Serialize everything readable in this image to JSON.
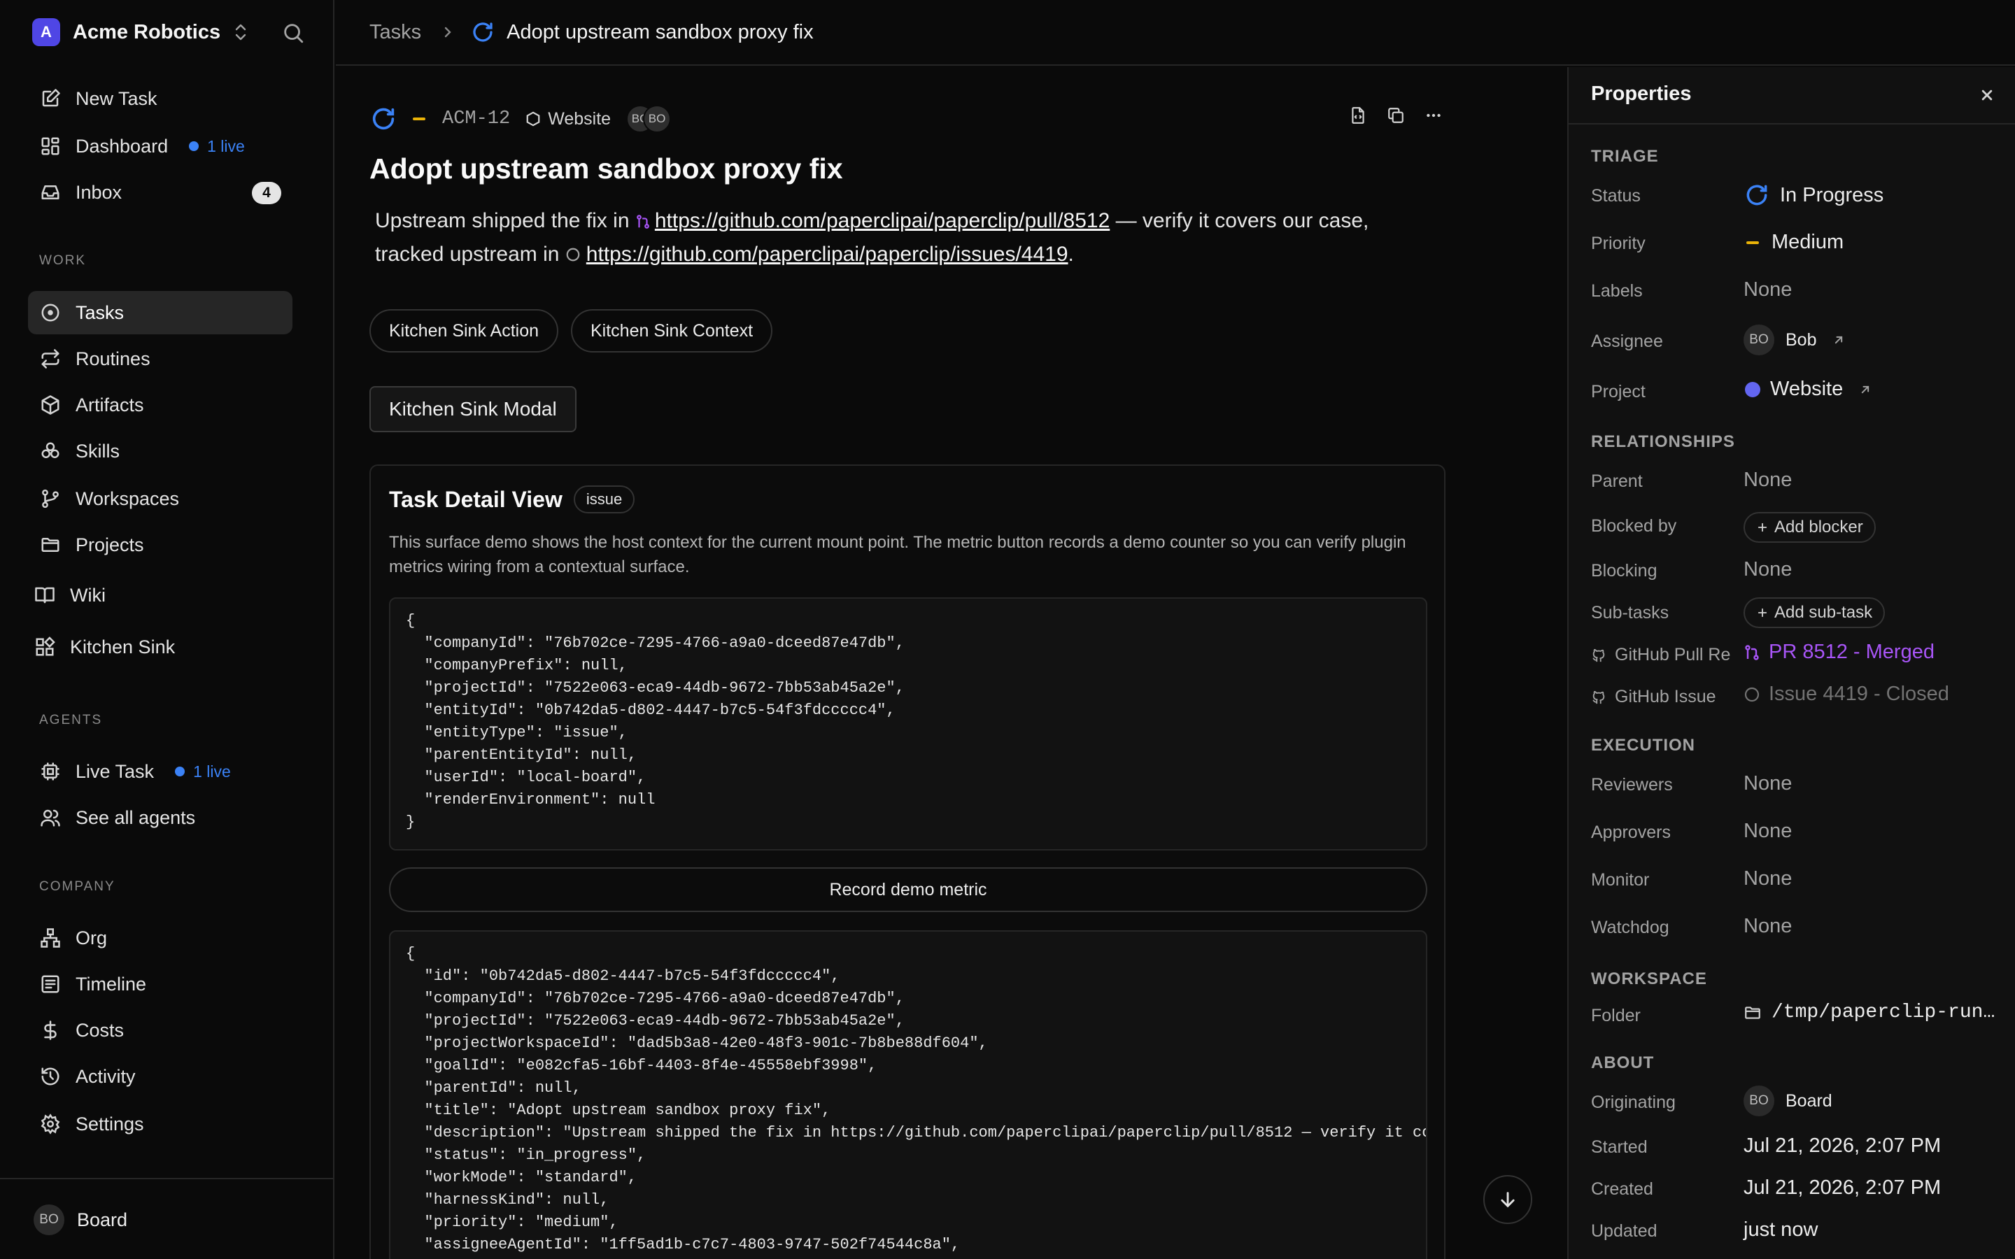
{
  "sidebar": {
    "company_name": "Acme Robotics",
    "company_initial": "A",
    "new_task": "New Task",
    "dashboard": "Dashboard",
    "dashboard_badge": "1 live",
    "inbox": "Inbox",
    "inbox_count": "4",
    "work_heading": "WORK",
    "work_items": [
      "Tasks",
      "Routines",
      "Artifacts",
      "Skills",
      "Workspaces",
      "Projects"
    ],
    "wiki": "Wiki",
    "kitchen_sink": "Kitchen Sink",
    "agents_heading": "AGENTS",
    "live_task": "Live Task",
    "live_task_badge": "1 live",
    "see_all_agents": "See all agents",
    "company_heading": "COMPANY",
    "company_items": [
      "Org",
      "Timeline",
      "Costs",
      "Activity",
      "Settings"
    ],
    "user_initials": "BO",
    "user_name": "Board"
  },
  "topbar": {
    "root": "Tasks",
    "current": "Adopt upstream sandbox proxy fix"
  },
  "task": {
    "id": "ACM-12",
    "project": "Website",
    "avatars": [
      "BO",
      "BO"
    ],
    "title": "Adopt upstream sandbox proxy fix",
    "desc_part1": "Upstream shipped the fix in ",
    "pr_url": "https://github.com/paperclipai/paperclip/pull/8512",
    "desc_part2": " — verify it covers our case, tracked upstream in ",
    "issue_url": "https://github.com/paperclipai/paperclip/issues/4419",
    "desc_part3": ".",
    "action_buttons": [
      "Kitchen Sink Action",
      "Kitchen Sink Context"
    ],
    "modal_button": "Kitchen Sink Modal"
  },
  "detail_card": {
    "title": "Task Detail View",
    "badge": "issue",
    "text": "This surface demo shows the host context for the current mount point. The metric button records a demo counter so you can verify plugin metrics wiring from a contextual surface.",
    "context_json": "{\n  \"companyId\": \"76b702ce-7295-4766-a9a0-dceed87e47db\",\n  \"companyPrefix\": null,\n  \"projectId\": \"7522e063-eca9-44db-9672-7bb53ab45a2e\",\n  \"entityId\": \"0b742da5-d802-4447-b7c5-54f3fdccccc4\",\n  \"entityType\": \"issue\",\n  \"parentEntityId\": null,\n  \"userId\": \"local-board\",\n  \"renderEnvironment\": null\n}",
    "metric_button": "Record demo metric",
    "entity_json": "{\n  \"id\": \"0b742da5-d802-4447-b7c5-54f3fdccccc4\",\n  \"companyId\": \"76b702ce-7295-4766-a9a0-dceed87e47db\",\n  \"projectId\": \"7522e063-eca9-44db-9672-7bb53ab45a2e\",\n  \"projectWorkspaceId\": \"dad5b3a8-42e0-48f3-901c-7b8be88df604\",\n  \"goalId\": \"e082cfa5-16bf-4403-8f4e-45558ebf3998\",\n  \"parentId\": null,\n  \"title\": \"Adopt upstream sandbox proxy fix\",\n  \"description\": \"Upstream shipped the fix in https://github.com/paperclipai/paperclip/pull/8512 — verify it co\",\n  \"status\": \"in_progress\",\n  \"workMode\": \"standard\",\n  \"harnessKind\": null,\n  \"priority\": \"medium\",\n  \"assigneeAgentId\": \"1ff5ad1b-c7c7-4803-9747-502f74544c8a\","
  },
  "properties": {
    "title": "Properties",
    "triage": "TRIAGE",
    "status_label": "Status",
    "status_value": "In Progress",
    "priority_label": "Priority",
    "priority_value": "Medium",
    "labels_label": "Labels",
    "labels_value": "None",
    "assignee_label": "Assignee",
    "assignee_initials": "BO",
    "assignee_value": "Bob",
    "project_label": "Project",
    "project_value": "Website",
    "relationships": "RELATIONSHIPS",
    "parent_label": "Parent",
    "parent_value": "None",
    "blocked_by_label": "Blocked by",
    "add_blocker": "Add blocker",
    "blocking_label": "Blocking",
    "blocking_value": "None",
    "subtasks_label": "Sub-tasks",
    "add_subtask": "Add sub-task",
    "gh_pr_label": "GitHub Pull Re",
    "gh_pr_value": "PR 8512 - Merged",
    "gh_issue_label": "GitHub Issue",
    "gh_issue_value": "Issue 4419 - Closed",
    "execution": "EXECUTION",
    "reviewers_label": "Reviewers",
    "reviewers_value": "None",
    "approvers_label": "Approvers",
    "approvers_value": "None",
    "monitor_label": "Monitor",
    "monitor_value": "None",
    "watchdog_label": "Watchdog",
    "watchdog_value": "None",
    "workspace": "WORKSPACE",
    "folder_label": "Folder",
    "folder_value": "/tmp/paperclip-run…",
    "about": "ABOUT",
    "originating_label": "Originating",
    "originating_initials": "BO",
    "originating_value": "Board",
    "started_label": "Started",
    "started_value": "Jul 21, 2026, 2:07 PM",
    "created_label": "Created",
    "created_value": "Jul 21, 2026, 2:07 PM",
    "updated_label": "Updated",
    "updated_value": "just now"
  },
  "colors": {
    "accent": "#3b82f6",
    "priority_medium": "#eab308",
    "project_dot": "#6366f1",
    "merged": "#a855f7"
  }
}
